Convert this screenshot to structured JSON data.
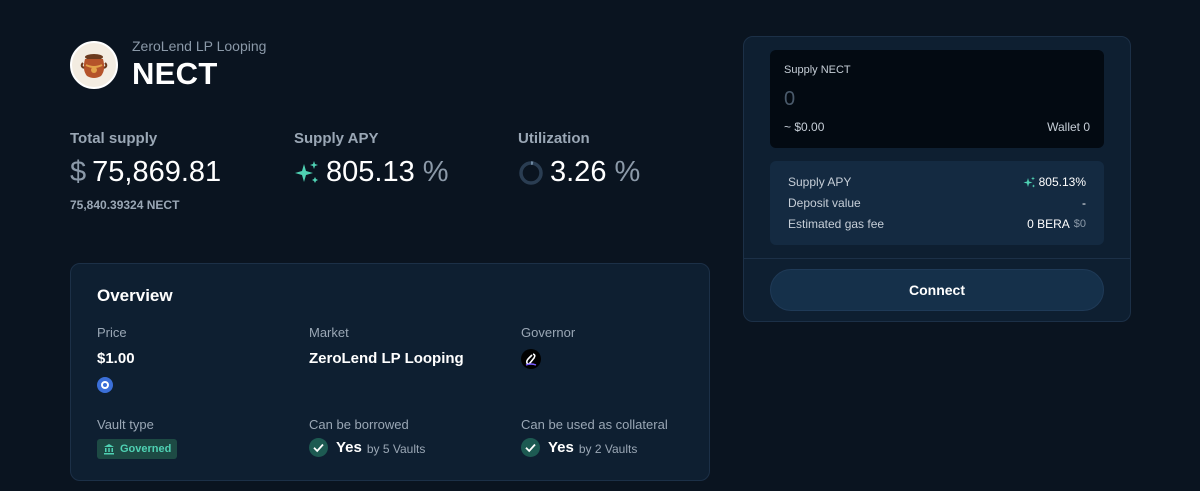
{
  "header": {
    "subtitle": "ZeroLend LP Looping",
    "title": "NECT"
  },
  "stats": {
    "total_supply": {
      "label": "Total supply",
      "prefix": "$",
      "value": "75,869.81",
      "sub": "75,840.39324 NECT"
    },
    "supply_apy": {
      "label": "Supply APY",
      "value": "805.13",
      "suffix": "%"
    },
    "utilization": {
      "label": "Utilization",
      "value": "3.26",
      "suffix": "%",
      "fraction": 0.0326
    }
  },
  "overview": {
    "title": "Overview",
    "price": {
      "label": "Price",
      "value": "$1.00"
    },
    "market": {
      "label": "Market",
      "value": "ZeroLend LP Looping"
    },
    "governor": {
      "label": "Governor"
    },
    "vault_type": {
      "label": "Vault type",
      "badge": "Governed"
    },
    "borrowed": {
      "label": "Can be borrowed",
      "yes": "Yes",
      "by": "by 5 Vaults"
    },
    "collateral": {
      "label": "Can be used as collateral",
      "yes": "Yes",
      "by": "by 2 Vaults"
    }
  },
  "panel": {
    "input_label": "Supply NECT",
    "placeholder": "0",
    "usd_value": "~ $0.00",
    "wallet": "Wallet 0",
    "rows": [
      {
        "label": "Supply APY",
        "value": "805.13%"
      },
      {
        "label": "Deposit value",
        "value": "-"
      },
      {
        "label": "Estimated gas fee",
        "value": "0 BERA",
        "extra": "$0"
      }
    ],
    "connect_label": "Connect"
  },
  "colors": {
    "accent": "#4fd1b3",
    "background": "#0a1420",
    "card": "#0e1f31"
  }
}
